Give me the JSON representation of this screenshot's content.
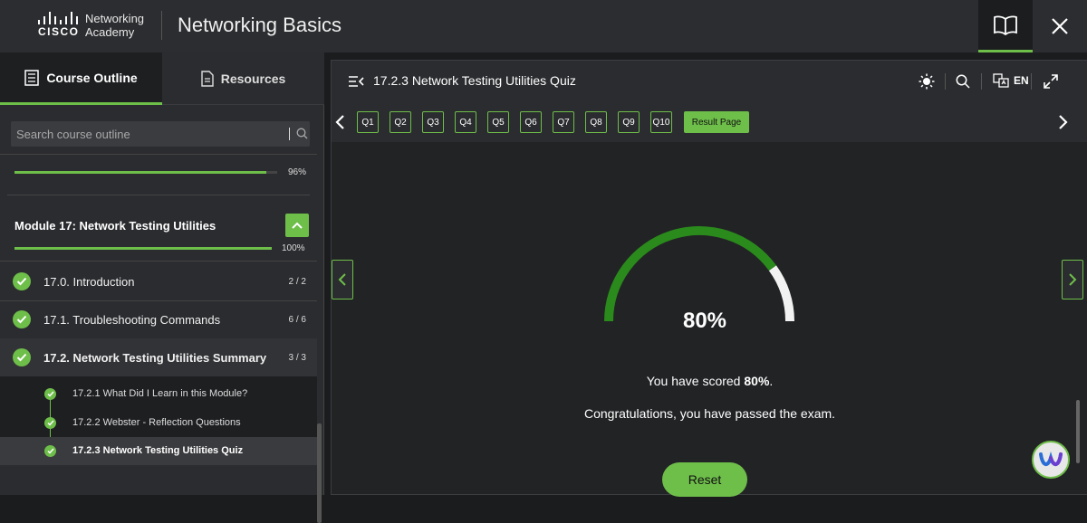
{
  "header": {
    "brand_word": "CISCO",
    "brand_line1": "Networking",
    "brand_line2": "Academy",
    "title": "Networking Basics",
    "book_icon": "book-open-icon",
    "close_icon": "close-icon"
  },
  "sidebar": {
    "tabs": [
      {
        "label": "Course Outline",
        "icon": "outline-icon",
        "active": true
      },
      {
        "label": "Resources",
        "icon": "document-icon",
        "active": false
      }
    ],
    "search_placeholder": "Search course outline",
    "top_progress": {
      "value": 0.96,
      "label": "96%"
    },
    "module": {
      "title": "Module 17: Network Testing Utilities",
      "progress": {
        "value": 1.0,
        "label": "100%"
      }
    },
    "items": [
      {
        "label": "17.0. Introduction",
        "count": "2 / 2"
      },
      {
        "label": "17.1. Troubleshooting Commands",
        "count": "6 / 6"
      },
      {
        "label": "17.2. Network Testing Utilities Summary",
        "count": "3 / 3"
      }
    ],
    "subitems": [
      {
        "label": "17.2.1 What Did I Learn in this Module?"
      },
      {
        "label": "17.2.2 Webster - Reflection Questions"
      },
      {
        "label": "17.2.3 Network Testing Utilities Quiz"
      }
    ]
  },
  "panel": {
    "title": "17.2.3 Network Testing Utilities Quiz",
    "lang": "EN",
    "questions": [
      "Q1",
      "Q2",
      "Q3",
      "Q4",
      "Q5",
      "Q6",
      "Q7",
      "Q8",
      "Q9",
      "Q10"
    ],
    "result_label": "Result Page",
    "score": {
      "value": 0.8,
      "label": "80%"
    },
    "score_text_prefix": "You have scored ",
    "score_text_value": "80%",
    "score_text_suffix": ".",
    "congrats": "Congratulations, you have passed the exam.",
    "reset_label": "Reset"
  },
  "colors": {
    "accent": "#6ebe4a",
    "gauge_fill": "#2a8a1c",
    "gauge_rest": "#f2f2f2"
  }
}
